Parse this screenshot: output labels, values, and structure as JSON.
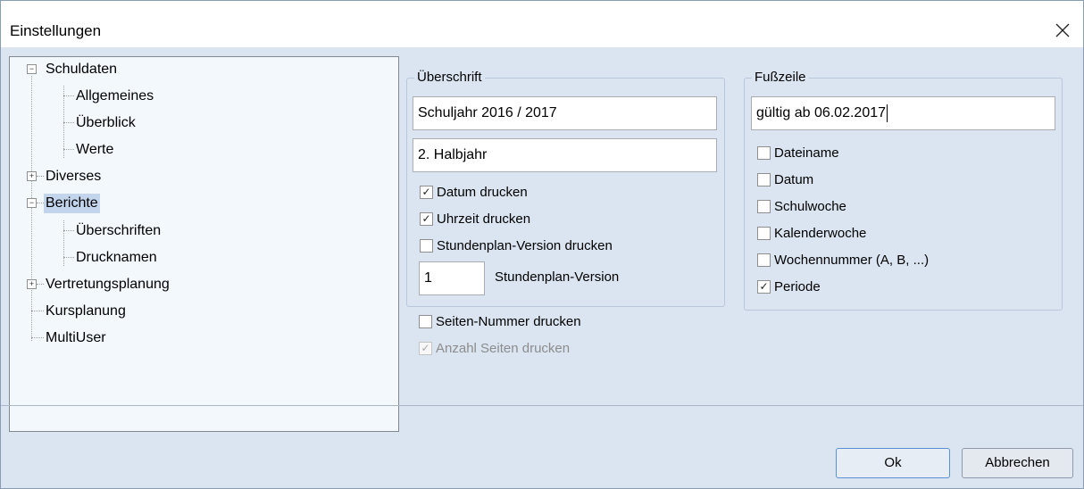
{
  "window": {
    "title": "Einstellungen",
    "close_icon": "close-icon"
  },
  "tree": {
    "items": [
      {
        "label": "Schuldaten",
        "expanded": true
      },
      {
        "label": "Allgemeines"
      },
      {
        "label": "Überblick"
      },
      {
        "label": "Werte"
      },
      {
        "label": "Diverses",
        "expanded": false
      },
      {
        "label": "Berichte",
        "expanded": true,
        "selected": true
      },
      {
        "label": "Überschriften"
      },
      {
        "label": "Drucknamen"
      },
      {
        "label": "Vertretungsplanung",
        "expanded": false
      },
      {
        "label": "Kursplanung"
      },
      {
        "label": "MultiUser"
      }
    ],
    "expanded_glyph": "−",
    "collapsed_glyph": "+"
  },
  "ueberschrift": {
    "label": "Überschrift",
    "line1": "Schuljahr 2016 / 2017",
    "line2": "2. Halbjahr",
    "checkboxes": [
      {
        "label": "Datum drucken",
        "checked": true
      },
      {
        "label": "Uhrzeit drucken",
        "checked": true
      },
      {
        "label": "Stundenplan-Version drucken",
        "checked": false
      }
    ],
    "version_value": "1",
    "version_label": "Stundenplan-Version"
  },
  "seiten": {
    "seiten_nummer": {
      "label": "Seiten-Nummer drucken",
      "checked": false
    },
    "anzahl_seiten": {
      "label": "Anzahl Seiten drucken",
      "checked": true,
      "disabled": true
    }
  },
  "fusszeile": {
    "label": "Fußzeile",
    "text": "gültig ab 06.02.2017",
    "checkboxes": [
      {
        "label": "Dateiname",
        "checked": false
      },
      {
        "label": "Datum",
        "checked": false
      },
      {
        "label": "Schulwoche",
        "checked": false
      },
      {
        "label": "Kalenderwoche",
        "checked": false
      },
      {
        "label": "Wochennummer (A, B, ...)",
        "checked": false
      },
      {
        "label": "Periode",
        "checked": true
      }
    ]
  },
  "buttons": {
    "ok": "Ok",
    "cancel": "Abbrechen"
  },
  "check_glyph": "✓"
}
